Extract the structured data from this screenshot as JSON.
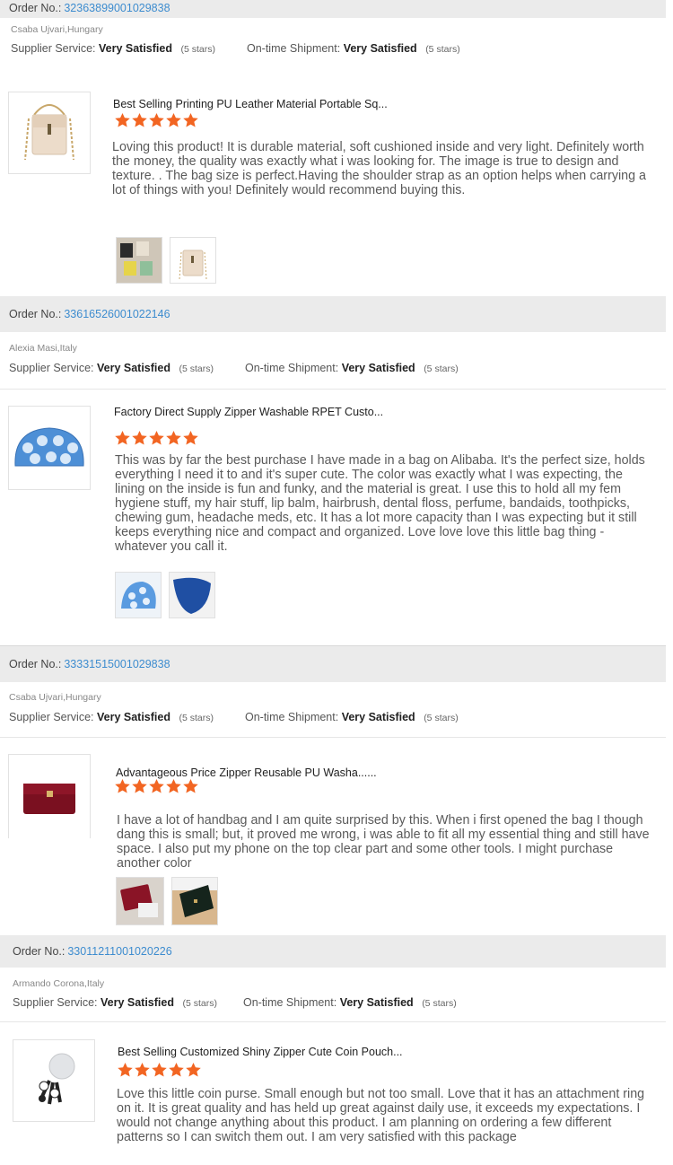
{
  "labels": {
    "order_no": "Order No.:",
    "supplier_service": "Supplier Service:",
    "ontime_shipment": "On-time Shipment:",
    "stars_note": "(5 stars)"
  },
  "colors": {
    "star": "#f26522",
    "link": "#3d8ccf",
    "bar": "#ebebeb"
  },
  "reviews": [
    {
      "order_no": "32363899001029838",
      "buyer": "Csaba Ujvari,Hungary",
      "supplier_rating": "Very Satisfied",
      "shipment_rating": "Very Satisfied",
      "product_title": "Best Selling Printing PU Leather Material Portable Sq...",
      "rating": 5,
      "comment": "Loving this product! It is durable material, soft cushioned inside and very light. Definitely worth the money, the quality was exactly what i was looking for. The image is true to design and texture. . The bag size is perfect.Having the shoulder strap as an option helps when carrying a lot of things with you! Definitely would recommend buying this.",
      "photos": 2
    },
    {
      "order_no": "33616526001022146",
      "buyer": "Alexia Masi,Italy",
      "supplier_rating": "Very Satisfied",
      "shipment_rating": "Very Satisfied",
      "product_title": "Factory Direct Supply Zipper Washable RPET Custo...",
      "rating": 5,
      "comment": "This was by far the best purchase I have made in a bag on Alibaba. It's the perfect size, holds everything I need it to and it's super cute. The color was exactly what I was expecting, the lining on the inside is fun and funky, and the material is great. I use this to hold all my fem hygiene stuff, my hair stuff, lip balm, hairbrush, dental floss, perfume, bandaids, toothpicks, chewing gum, headache meds, etc. It has a lot more capacity than I was expecting but it still keeps everything nice and compact and organized. Love love love this little bag thing - whatever you call it.",
      "photos": 2
    },
    {
      "order_no": "33331515001029838",
      "buyer": "Csaba Ujvari,Hungary",
      "supplier_rating": "Very Satisfied",
      "shipment_rating": "Very Satisfied",
      "product_title": "Advantageous Price Zipper Reusable PU Washa......",
      "rating": 5,
      "comment": "I have a lot of handbag and I am quite surprised by this. When i first opened the bag I though dang this is small; but, it proved me wrong, i was able to fit all my essential thing and still have space. I also put my phone on the top clear part and some other tools. I might purchase another color",
      "photos": 2
    },
    {
      "order_no": "33011211001020226",
      "buyer": "Armando Corona,Italy",
      "supplier_rating": "Very Satisfied",
      "shipment_rating": "Very Satisfied",
      "product_title": "Best Selling Customized Shiny Zipper Cute Coin Pouch...",
      "rating": 5,
      "comment": "Love this little coin purse. Small enough but not too small. Love that it has an attachment ring on it. It is great quality and has held up great against daily use, it exceeds my expectations. I would not change anything about this product. I am planning on ordering a few different patterns so I can switch them out. I am very satisfied with this package",
      "photos": 0
    }
  ]
}
